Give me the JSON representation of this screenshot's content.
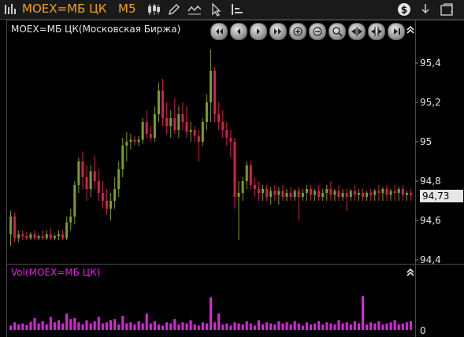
{
  "toolbar": {
    "symbol": "MOEX=МБ ЦК",
    "timeframe": "M5",
    "icons": [
      "chart-settings-icon",
      "candles-icon",
      "pencil-icon",
      "indicators-icon",
      "cursor-icon",
      "layout-icon",
      "dollar-icon",
      "download-icon",
      "expand-icon"
    ]
  },
  "price_panel": {
    "title": "MOEX=МБ ЦК(Московская Биржа)",
    "nav_buttons": [
      "scroll-start",
      "scroll-back",
      "scroll-forward",
      "scroll-end",
      "zoom-in",
      "zoom-out",
      "zoom-region",
      "fit-horizontal",
      "fit-vertical",
      "jump-end"
    ],
    "last_price_label": "94,73"
  },
  "volume_panel": {
    "title": "Vol(MOEX=МБ ЦК)"
  },
  "colors": {
    "up": "#7a9a2a",
    "down": "#d0204a",
    "volume": "#e020e0",
    "symbol": "#f0a020",
    "panel_bg": "#000000"
  },
  "chart_data": [
    {
      "type": "candlestick",
      "title": "MOEX=МБ ЦК(Московская Биржа)",
      "timeframe": "M5",
      "ylim": [
        94.4,
        95.6
      ],
      "yticks": [
        94.4,
        94.6,
        94.8,
        95,
        95.2,
        95.4
      ],
      "ytick_labels": [
        "94,4",
        "94,6",
        "94,8",
        "95",
        "95,2",
        "95,4"
      ],
      "last_price": 94.73,
      "grid": false,
      "candles": [
        [
          94.53,
          94.65,
          94.47,
          94.62
        ],
        [
          94.62,
          94.64,
          94.49,
          94.51
        ],
        [
          94.51,
          94.55,
          94.49,
          94.53
        ],
        [
          94.53,
          94.55,
          94.5,
          94.52
        ],
        [
          94.52,
          94.54,
          94.5,
          94.51
        ],
        [
          94.51,
          94.54,
          94.5,
          94.53
        ],
        [
          94.53,
          94.55,
          94.5,
          94.51
        ],
        [
          94.51,
          94.53,
          94.5,
          94.52
        ],
        [
          94.52,
          94.55,
          94.5,
          94.51
        ],
        [
          94.51,
          94.55,
          94.5,
          94.53
        ],
        [
          94.53,
          94.56,
          94.5,
          94.51
        ],
        [
          94.51,
          94.53,
          94.5,
          94.52
        ],
        [
          94.52,
          94.55,
          94.5,
          94.53
        ],
        [
          94.53,
          94.55,
          94.5,
          94.51
        ],
        [
          94.51,
          94.62,
          94.5,
          94.59
        ],
        [
          94.59,
          94.66,
          94.55,
          94.62
        ],
        [
          94.62,
          94.8,
          94.58,
          94.78
        ],
        [
          94.78,
          94.92,
          94.74,
          94.9
        ],
        [
          94.9,
          94.95,
          94.76,
          94.82
        ],
        [
          94.82,
          94.88,
          94.7,
          94.76
        ],
        [
          94.76,
          94.88,
          94.72,
          94.85
        ],
        [
          94.85,
          94.93,
          94.76,
          94.8
        ],
        [
          94.8,
          94.86,
          94.7,
          94.74
        ],
        [
          94.74,
          94.8,
          94.66,
          94.7
        ],
        [
          94.7,
          94.76,
          94.63,
          94.66
        ],
        [
          94.66,
          94.74,
          94.6,
          94.7
        ],
        [
          94.7,
          94.82,
          94.66,
          94.76
        ],
        [
          94.76,
          94.9,
          94.72,
          94.86
        ],
        [
          94.86,
          95.02,
          94.82,
          94.98
        ],
        [
          94.98,
          95.05,
          94.9,
          95.0
        ],
        [
          95.0,
          95.04,
          94.96,
          95.01
        ],
        [
          95.01,
          95.03,
          94.98,
          95.0
        ],
        [
          95.0,
          95.03,
          94.98,
          95.01
        ],
        [
          95.01,
          95.12,
          94.99,
          95.1
        ],
        [
          95.1,
          95.16,
          95.02,
          95.04
        ],
        [
          95.04,
          95.08,
          95.0,
          95.02
        ],
        [
          95.02,
          95.18,
          95.0,
          95.14
        ],
        [
          95.14,
          95.3,
          95.1,
          95.26
        ],
        [
          95.26,
          95.32,
          95.08,
          95.12
        ],
        [
          95.12,
          95.2,
          95.04,
          95.08
        ],
        [
          95.08,
          95.16,
          95.02,
          95.12
        ],
        [
          95.12,
          95.22,
          95.04,
          95.06
        ],
        [
          95.06,
          95.18,
          95.02,
          95.14
        ],
        [
          95.14,
          95.2,
          95.06,
          95.1
        ],
        [
          95.1,
          95.18,
          95.02,
          95.05
        ],
        [
          95.05,
          95.1,
          95.0,
          95.06
        ],
        [
          95.06,
          95.08,
          95.0,
          95.03
        ],
        [
          95.03,
          95.06,
          94.9,
          95.0
        ],
        [
          95.0,
          95.12,
          94.98,
          95.1
        ],
        [
          95.1,
          95.24,
          95.06,
          95.2
        ],
        [
          95.2,
          95.47,
          95.1,
          95.36
        ],
        [
          95.36,
          95.38,
          95.1,
          95.14
        ],
        [
          95.14,
          95.2,
          95.06,
          95.1
        ],
        [
          95.1,
          95.16,
          95.02,
          95.06
        ],
        [
          95.06,
          95.1,
          94.98,
          95.02
        ],
        [
          95.02,
          95.06,
          94.92,
          95.0
        ],
        [
          95.0,
          95.02,
          94.66,
          94.72
        ],
        [
          94.72,
          94.8,
          94.5,
          94.74
        ],
        [
          94.74,
          94.82,
          94.7,
          94.8
        ],
        [
          94.8,
          94.9,
          94.76,
          94.88
        ],
        [
          94.88,
          94.9,
          94.76,
          94.78
        ],
        [
          94.78,
          94.82,
          94.72,
          94.76
        ],
        [
          94.76,
          94.8,
          94.7,
          94.74
        ],
        [
          94.74,
          94.78,
          94.7,
          94.76
        ],
        [
          94.76,
          94.78,
          94.7,
          94.72
        ],
        [
          94.72,
          94.77,
          94.68,
          94.75
        ],
        [
          94.75,
          94.78,
          94.7,
          94.73
        ],
        [
          94.73,
          94.77,
          94.68,
          94.75
        ],
        [
          94.75,
          94.78,
          94.7,
          94.72
        ],
        [
          94.72,
          94.76,
          94.7,
          94.74
        ],
        [
          94.74,
          94.77,
          94.7,
          94.72
        ],
        [
          94.72,
          94.76,
          94.7,
          94.75
        ],
        [
          94.75,
          94.77,
          94.6,
          94.72
        ],
        [
          94.72,
          94.76,
          94.7,
          94.74
        ],
        [
          94.74,
          94.78,
          94.7,
          94.76
        ],
        [
          94.76,
          94.78,
          94.7,
          94.73
        ],
        [
          94.73,
          94.76,
          94.7,
          94.75
        ],
        [
          94.75,
          94.78,
          94.7,
          94.72
        ],
        [
          94.72,
          94.76,
          94.7,
          94.74
        ],
        [
          94.74,
          94.78,
          94.7,
          94.76
        ],
        [
          94.76,
          94.8,
          94.7,
          94.73
        ],
        [
          94.73,
          94.76,
          94.7,
          94.75
        ],
        [
          94.75,
          94.78,
          94.7,
          94.72
        ],
        [
          94.72,
          94.76,
          94.7,
          94.74
        ],
        [
          94.74,
          94.76,
          94.65,
          94.72
        ],
        [
          94.72,
          94.76,
          94.7,
          94.75
        ],
        [
          94.75,
          94.78,
          94.7,
          94.73
        ],
        [
          94.73,
          94.76,
          94.7,
          94.74
        ],
        [
          94.74,
          94.76,
          94.7,
          94.72
        ],
        [
          94.72,
          94.75,
          94.7,
          94.74
        ],
        [
          94.74,
          94.76,
          94.7,
          94.73
        ],
        [
          94.73,
          94.76,
          94.7,
          94.75
        ],
        [
          94.75,
          94.78,
          94.7,
          94.74
        ],
        [
          94.74,
          94.77,
          94.7,
          94.76
        ],
        [
          94.76,
          94.78,
          94.7,
          94.73
        ],
        [
          94.73,
          94.76,
          94.7,
          94.75
        ],
        [
          94.75,
          94.78,
          94.7,
          94.74
        ],
        [
          94.74,
          94.77,
          94.7,
          94.76
        ],
        [
          94.76,
          94.78,
          94.7,
          94.73
        ],
        [
          94.73,
          94.75,
          94.7,
          94.74
        ],
        [
          94.74,
          94.76,
          94.7,
          94.73
        ]
      ]
    },
    {
      "type": "bar",
      "title": "Vol(MOEX=МБ ЦК)",
      "ylim": [
        0,
        100
      ],
      "yticks": [
        0
      ],
      "ytick_labels": [
        "0"
      ],
      "values": [
        8,
        14,
        10,
        12,
        9,
        15,
        22,
        12,
        16,
        10,
        24,
        14,
        18,
        12,
        30,
        20,
        22,
        14,
        10,
        18,
        12,
        16,
        24,
        12,
        14,
        18,
        20,
        10,
        26,
        12,
        14,
        10,
        16,
        12,
        30,
        12,
        16,
        10,
        8,
        14,
        12,
        20,
        10,
        14,
        12,
        18,
        10,
        8,
        14,
        12,
        60,
        14,
        30,
        10,
        12,
        8,
        14,
        12,
        10,
        16,
        12,
        8,
        18,
        10,
        14,
        12,
        10,
        16,
        12,
        14,
        10,
        16,
        12,
        8,
        14,
        10,
        12,
        16,
        10,
        14,
        12,
        10,
        18,
        12,
        14,
        10,
        16,
        12,
        62,
        10,
        14,
        12,
        16,
        10,
        12,
        14,
        18,
        10,
        12,
        14,
        16
      ]
    }
  ]
}
